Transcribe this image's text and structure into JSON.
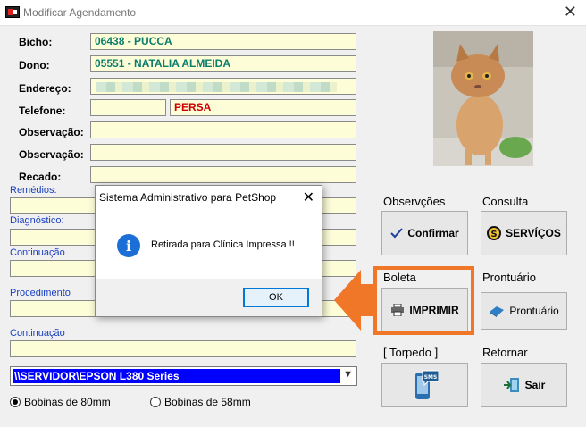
{
  "window": {
    "title": "Modificar Agendamento",
    "close_glyph": "✕"
  },
  "form": {
    "bicho_label": "Bicho:",
    "bicho_value": "06438 - PUCCA",
    "dono_label": "Dono:",
    "dono_value": "05551 - NATALIA ALMEIDA",
    "endereco_label": "Endereço:",
    "telefone_label": "Telefone:",
    "raca_value": "PERSA",
    "observacao1_label": "Observação:",
    "observacao2_label": "Observação:",
    "recado_label": "Recado:",
    "remedios_label": "Remédios:",
    "diagnostico_label": "Diagnóstico:",
    "continuacao1_label": "Continuação",
    "procedimento_label": "Procedimento",
    "continuacao2_label": "Continuação"
  },
  "groups": {
    "observacoes": {
      "label": "Observções",
      "button": "Confirmar"
    },
    "consulta": {
      "label": "Consulta",
      "button": "SERVÍÇOS"
    },
    "boleta": {
      "label": "Boleta",
      "button": "IMPRIMIR"
    },
    "prontuario": {
      "label": "Prontuário",
      "button": "Prontuário"
    },
    "torpedo": {
      "label": "[ Torpedo ]",
      "button_icon_text": "SMS"
    },
    "retornar": {
      "label": "Retornar",
      "button": "Sair"
    }
  },
  "printer": {
    "selected": "\\\\SERVIDOR\\EPSON L380 Series"
  },
  "radios": {
    "opt80": "Bobinas de 80mm",
    "opt58": "Bobinas de 58mm",
    "selected": "opt80"
  },
  "dialog": {
    "title": "Sistema Administrativo para PetShop",
    "message": "Retirada para Clínica Impressa !!",
    "ok_label": "OK",
    "close_glyph": "✕"
  },
  "colors": {
    "field_bg": "#fdfdd8",
    "code_text": "#0b7d6d",
    "accent_orange": "#f07628",
    "selection_blue": "#0000ff"
  }
}
